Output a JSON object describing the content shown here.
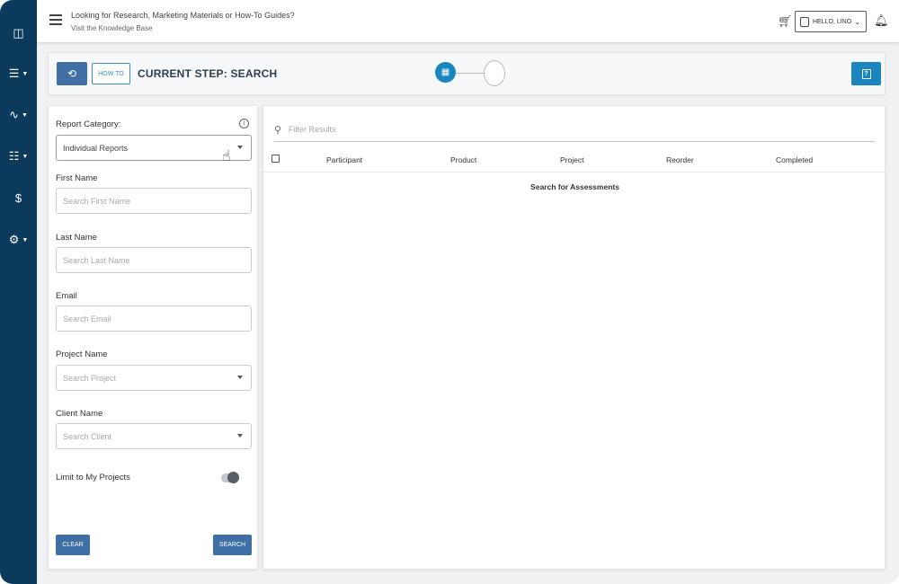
{
  "rail": {
    "items": [
      {
        "name": "dashboard-icon",
        "glyph": "◫",
        "caret": false
      },
      {
        "name": "reports-icon",
        "glyph": "☰",
        "caret": true
      },
      {
        "name": "analytics-icon",
        "glyph": "∿",
        "caret": true
      },
      {
        "name": "apps-icon",
        "glyph": "☷",
        "caret": true
      },
      {
        "name": "billing-icon",
        "glyph": "$",
        "caret": false
      },
      {
        "name": "settings-icon",
        "glyph": "⚙",
        "caret": true
      }
    ]
  },
  "topbar": {
    "kb_line1": "Looking for Research, Marketing Materials or How-To Guides?",
    "kb_line2": "Visit the Knowledge Base",
    "user_label": "HELLO, LINO"
  },
  "stepbar": {
    "howto_label": "HOW TO",
    "current_step": "CURRENT STEP:  SEARCH",
    "help_glyph": "?"
  },
  "filters": {
    "report_category_label": "Report Category:",
    "report_category_value": "Individual Reports",
    "first_name_label": "First Name",
    "first_name_placeholder": "Search First Name",
    "last_name_label": "Last Name",
    "last_name_placeholder": "Search Last Name",
    "email_label": "Email",
    "email_placeholder": "Search Email",
    "project_name_label": "Project Name",
    "project_name_placeholder": "Search Project",
    "client_name_label": "Client Name",
    "client_name_placeholder": "Search Client",
    "limit_label": "Limit to My Projects",
    "limit_on": false,
    "clear_label": "CLEAR",
    "search_label": "SEARCH"
  },
  "results": {
    "filter_placeholder": "Filter Results",
    "columns": [
      "Participant",
      "Product",
      "Project",
      "Reorder",
      "Completed"
    ],
    "empty_message": "Search for Assessments"
  },
  "colors": {
    "rail": "#0b3a5c",
    "primary_button": "#3f6fa4",
    "accent": "#1a86bd"
  }
}
